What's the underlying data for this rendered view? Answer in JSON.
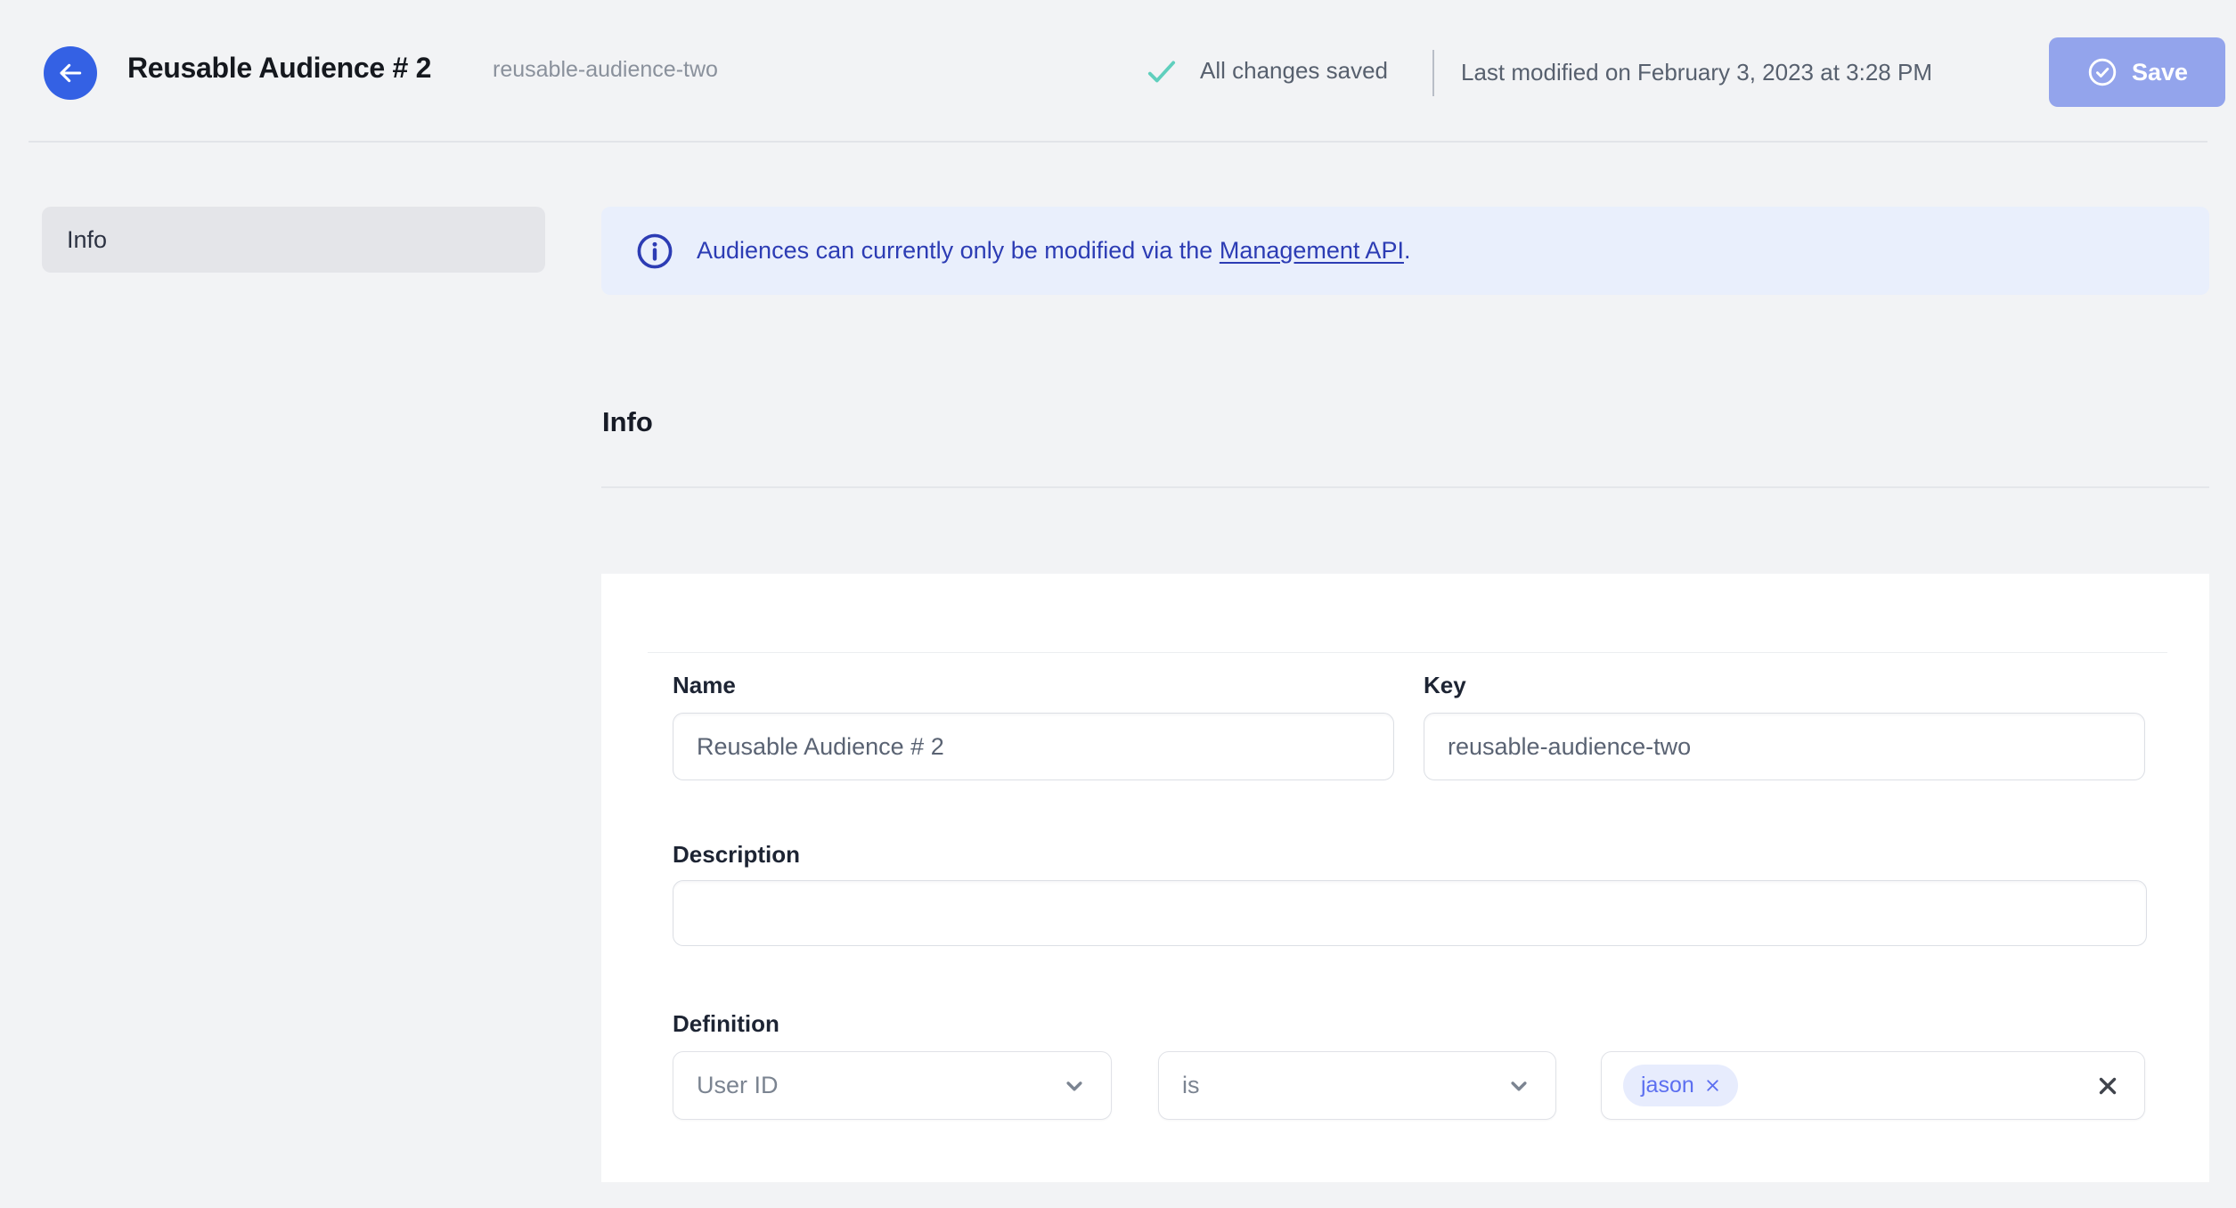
{
  "header": {
    "title": "Reusable Audience # 2",
    "slug": "reusable-audience-two",
    "save_status": "All changes saved",
    "last_modified": "Last modified on February 3, 2023 at 3:28 PM",
    "save_label": "Save"
  },
  "sidebar": {
    "items": [
      {
        "label": "Info",
        "active": true
      }
    ]
  },
  "banner": {
    "text_before_link": "Audiences can currently only be modified via the ",
    "link_text": "Management API",
    "text_after_link": "."
  },
  "section": {
    "heading": "Info"
  },
  "form": {
    "name": {
      "label": "Name",
      "value": "Reusable Audience # 2"
    },
    "key": {
      "label": "Key",
      "value": "reusable-audience-two"
    },
    "description": {
      "label": "Description",
      "value": ""
    },
    "definition": {
      "label": "Definition",
      "trait_selected": "User ID",
      "operator_selected": "is",
      "values": [
        "jason"
      ]
    }
  },
  "colors": {
    "accent_blue": "#3461e4",
    "save_button_bg": "#93a4ec",
    "success_teal": "#5fcfbd",
    "banner_bg": "#e9effc",
    "banner_text": "#2c3cb4",
    "chip_bg": "#e7ecfd",
    "chip_text": "#5c6ff0",
    "page_bg": "#f2f3f5"
  }
}
